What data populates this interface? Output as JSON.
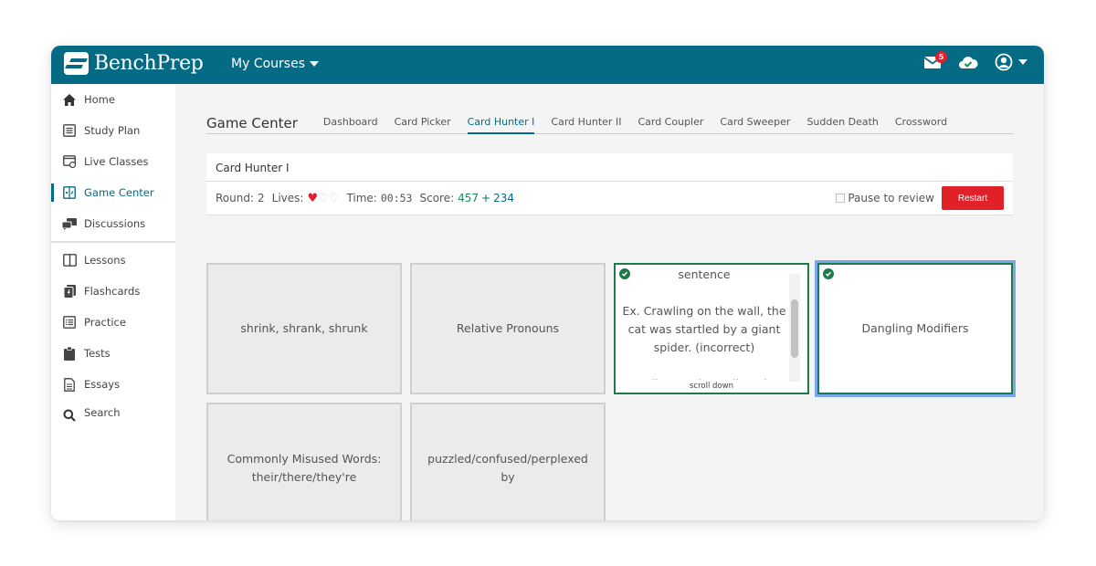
{
  "topbar": {
    "brand": "BenchPrep",
    "courses_menu": "My Courses",
    "notifications_count": "5",
    "colors": {
      "bar": "#056b85",
      "badge": "#e0202a"
    }
  },
  "sidebar": {
    "items": [
      {
        "label": "Home",
        "icon": "home-icon",
        "active": false
      },
      {
        "label": "Study Plan",
        "icon": "study-plan-icon",
        "active": false
      },
      {
        "label": "Live Classes",
        "icon": "live-classes-icon",
        "active": false
      },
      {
        "label": "Game Center",
        "icon": "game-center-icon",
        "active": true
      },
      {
        "label": "Discussions",
        "icon": "discussions-icon",
        "active": false
      },
      {
        "label": "Lessons",
        "icon": "lessons-icon",
        "active": false
      },
      {
        "label": "Flashcards",
        "icon": "flashcards-icon",
        "active": false
      },
      {
        "label": "Practice",
        "icon": "practice-icon",
        "active": false
      },
      {
        "label": "Tests",
        "icon": "tests-icon",
        "active": false
      },
      {
        "label": "Essays",
        "icon": "essays-icon",
        "active": false
      },
      {
        "label": "Search",
        "icon": "search-icon",
        "active": false
      }
    ]
  },
  "game_center": {
    "title": "Game Center",
    "tabs": [
      {
        "label": "Dashboard",
        "active": false
      },
      {
        "label": "Card Picker",
        "active": false
      },
      {
        "label": "Card Hunter I",
        "active": true
      },
      {
        "label": "Card Hunter II",
        "active": false
      },
      {
        "label": "Card Coupler",
        "active": false
      },
      {
        "label": "Card Sweeper",
        "active": false
      },
      {
        "label": "Sudden Death",
        "active": false
      },
      {
        "label": "Crossword",
        "active": false
      }
    ]
  },
  "game": {
    "title": "Card Hunter I",
    "round_label": "Round:",
    "round": "2",
    "lives_label": "Lives:",
    "lives_remaining": 1,
    "lives_total": 3,
    "time_label": "Time:",
    "time": "00:53",
    "score_label": "Score:",
    "score_base": "457",
    "score_plus": "+",
    "score_bonus": "234",
    "pause_label": "Pause to review",
    "pause_checked": false,
    "restart_label": "Restart",
    "cards": [
      {
        "text": "shrink, shrank, shrunk",
        "selected": false
      },
      {
        "text": "Relative Pronouns",
        "selected": false
      },
      {
        "text_lines": [
          "sentence",
          "",
          "Ex. Crawling on the wall, the cat was startled by a giant spider. (incorrect)",
          "",
          "Crawling on the wall, a giant"
        ],
        "selected": true,
        "scroll_hint": "scroll down"
      },
      {
        "text": "Dangling Modifiers",
        "selected": true,
        "focused": true
      },
      {
        "text": "Commonly Misused Words: their/there/they're",
        "selected": false
      },
      {
        "text": "puzzled/confused/perplexed by",
        "selected": false
      }
    ]
  }
}
